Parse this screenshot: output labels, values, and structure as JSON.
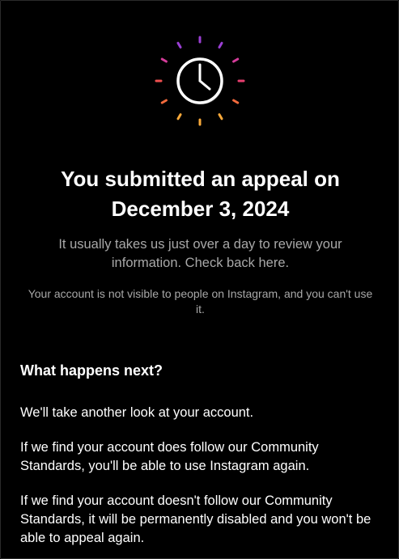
{
  "header": {
    "title": "You submitted an appeal on December 3, 2024",
    "subtitle": "It usually takes us just over a day to review your information. Check back here.",
    "notice": "Your account is not visible to people on Instagram, and you can't use it."
  },
  "next_steps": {
    "heading": "What happens next?",
    "paragraphs": [
      "We'll take another look at your account.",
      "If we find your account does follow our Community Standards, you'll be able to use Instagram again.",
      "If we find your account doesn't follow our Community Standards, it will be permanently disabled and you won't be able to appeal again."
    ]
  },
  "icon": {
    "name": "clock-icon",
    "ray_colors": [
      "#9b3fd4",
      "#b83bc9",
      "#d43c9a",
      "#e83e6f",
      "#f04f4f",
      "#f26a3c",
      "#f5892e",
      "#f9a93a"
    ]
  },
  "colors": {
    "background": "#000000",
    "primary_text": "#ffffff",
    "secondary_text": "#a8a8a8"
  }
}
